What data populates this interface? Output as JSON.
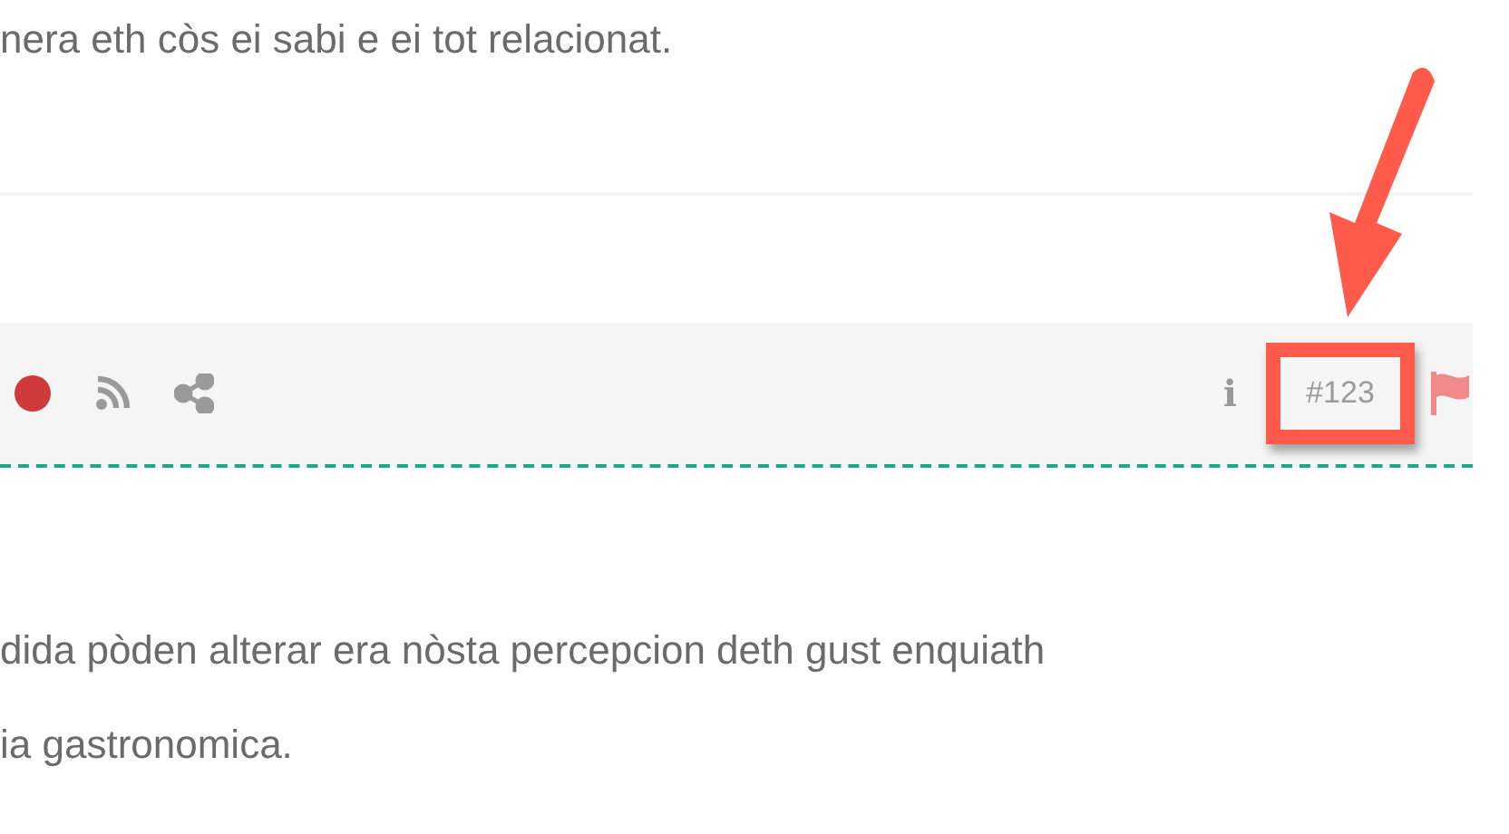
{
  "intro_text": "nera eth còs ei sabi e ei tot relacionat.",
  "toolbar": {
    "info": "i",
    "id_label": "#123",
    "id_highlighted": true
  },
  "body_lines": [
    "dida pòden alterar era nòsta percepcion deth gust enquiath",
    "ia gastronomica."
  ]
}
